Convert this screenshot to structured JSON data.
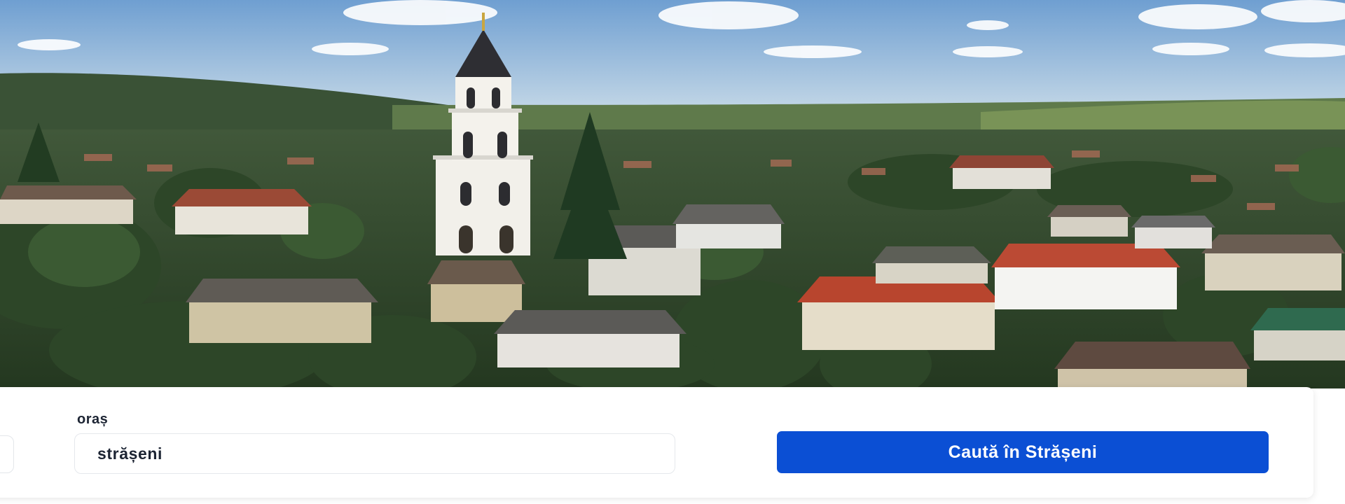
{
  "hero": {
    "image": "aerial-town-photo",
    "colors": {
      "sky": "#8fb8dd",
      "hills": "#3c5a3a",
      "trees": "#2f4a2a",
      "tower": "#f2f0ea",
      "roof_red": "#b8452e",
      "roof_grey": "#5b5a57"
    }
  },
  "search": {
    "city_label": "oraș",
    "city_value": "strășeni",
    "button_label": "Caută în Strășeni",
    "button_color": "#0b4fd4"
  }
}
